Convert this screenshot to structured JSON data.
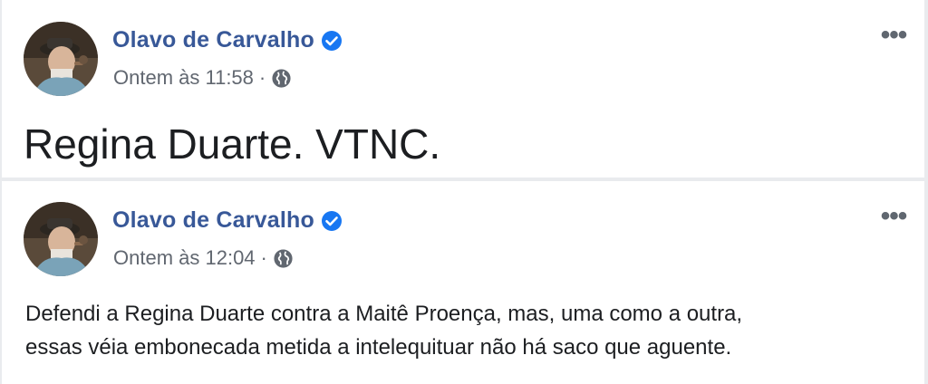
{
  "posts": [
    {
      "author": "Olavo de Carvalho",
      "verified": true,
      "timestamp": "Ontem às 11:58",
      "separator": "·",
      "privacy_icon": "globe-icon",
      "menu_icon": "more-options-icon",
      "text_lines": [
        "Regina Duarte. VTNC."
      ]
    },
    {
      "author": "Olavo de Carvalho",
      "verified": true,
      "timestamp": "Ontem às 12:04",
      "separator": "·",
      "privacy_icon": "globe-icon",
      "menu_icon": "more-options-icon",
      "text_lines": [
        "Defendi a Regina Duarte contra a Maitê Proença, mas, uma como a outra,",
        "essas véia embonecada metida a intelequituar não há saco que aguente."
      ]
    }
  ],
  "colors": {
    "author": "#385898",
    "verified": "#1877f2",
    "meta": "#616770",
    "text": "#1c1e21"
  }
}
